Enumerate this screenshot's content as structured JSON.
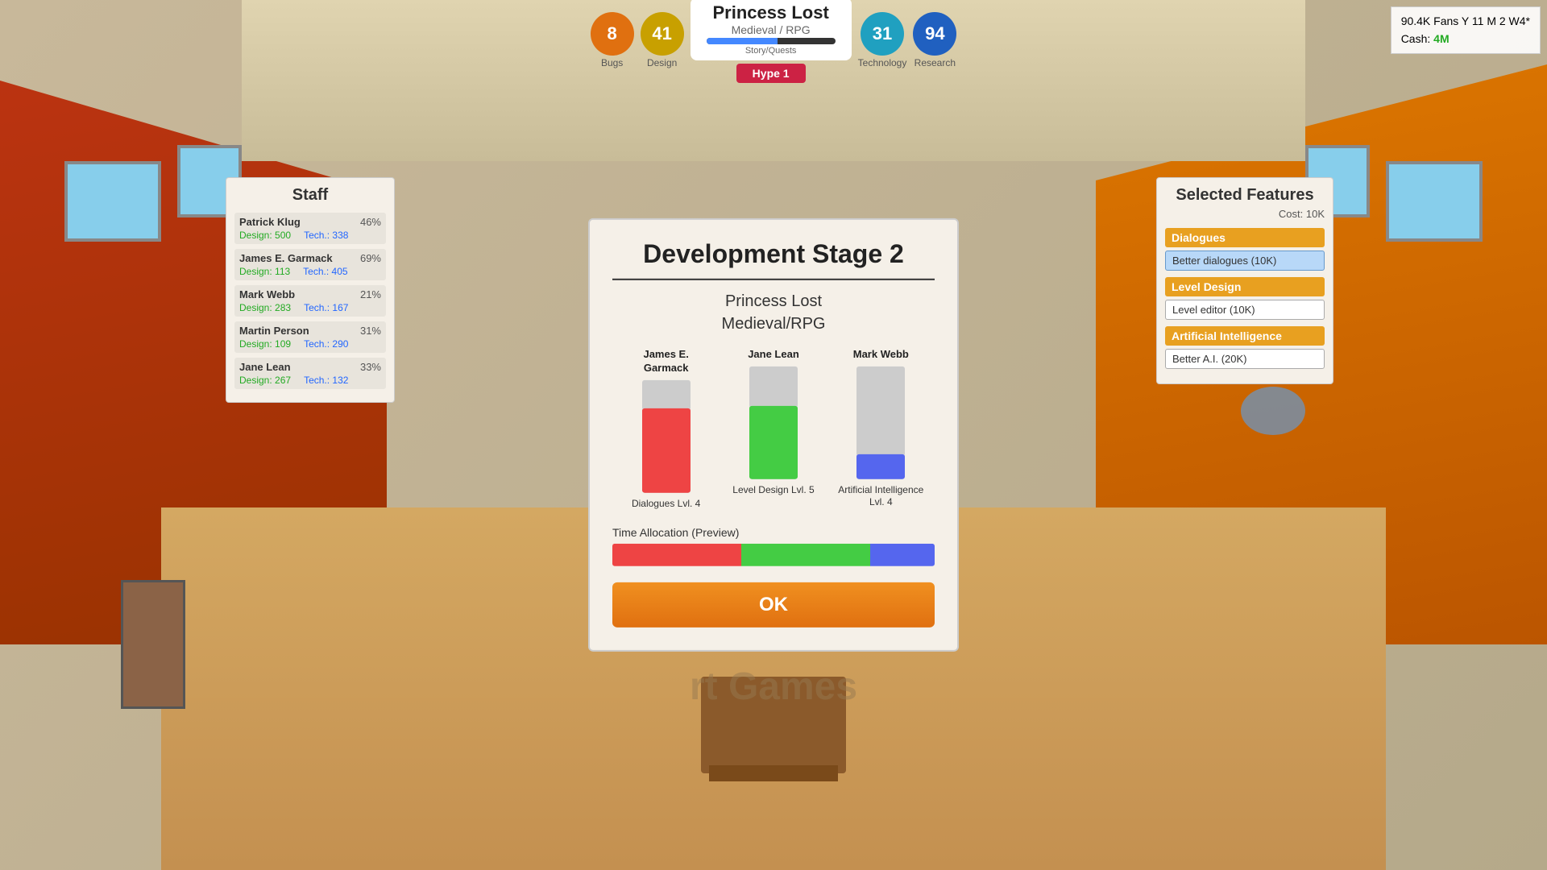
{
  "hud": {
    "bugs_count": "8",
    "bugs_label": "Bugs",
    "design_count": "41",
    "design_label": "Design",
    "game_title": "Princess Lost",
    "game_genre": "Medieval / RPG",
    "story_quests_label": "Story/Quests",
    "technology_count": "31",
    "technology_label": "Technology",
    "research_count": "94",
    "research_label": "Research",
    "hype_label": "Hype 1"
  },
  "stats": {
    "fans": "90.4K Fans Y 11 M 2 W4*",
    "cash_label": "Cash:",
    "cash_value": "4M"
  },
  "staff_panel": {
    "title": "Staff",
    "members": [
      {
        "name": "Patrick Klug",
        "percent": "46%",
        "design_label": "Design:",
        "design_value": "500",
        "tech_label": "Tech.:",
        "tech_value": "338"
      },
      {
        "name": "James E. Garmack",
        "percent": "69%",
        "design_label": "Design:",
        "design_value": "113",
        "tech_label": "Tech.:",
        "tech_value": "405"
      },
      {
        "name": "Mark Webb",
        "percent": "21%",
        "design_label": "Design:",
        "design_value": "283",
        "tech_label": "Tech.:",
        "tech_value": "167"
      },
      {
        "name": "Martin Person",
        "percent": "31%",
        "design_label": "Design:",
        "design_value": "109",
        "tech_label": "Tech.:",
        "tech_value": "290"
      },
      {
        "name": "Jane Lean",
        "percent": "33%",
        "design_label": "Design:",
        "design_value": "267",
        "tech_label": "Tech.:",
        "tech_value": "132"
      }
    ]
  },
  "dialog": {
    "title": "Development Stage 2",
    "game_name": "Princess Lost",
    "game_genre": "Medieval/RPG",
    "staff_bars": [
      {
        "name": "James E. Garmack",
        "fill_color": "red",
        "fill_height": "75",
        "label": "Dialogues Lvl. 4"
      },
      {
        "name": "Jane Lean",
        "fill_color": "green",
        "fill_height": "65",
        "label": "Level Design Lvl. 5"
      },
      {
        "name": "Mark Webb",
        "fill_color": "blue-bar",
        "fill_height": "22",
        "label": "Artificial Intelligence\nLvl. 4"
      }
    ],
    "time_allocation_label": "Time Allocation (Preview)",
    "ok_label": "OK"
  },
  "features_panel": {
    "title": "Selected Features",
    "cost": "Cost: 10K",
    "categories": [
      {
        "name": "Dialogues",
        "items": [
          {
            "label": "Better dialogues (10K)",
            "selected": true
          }
        ]
      },
      {
        "name": "Level Design",
        "items": [
          {
            "label": "Level editor (10K)",
            "selected": false
          }
        ]
      },
      {
        "name": "Artificial Intelligence",
        "items": [
          {
            "label": "Better A.I. (20K)",
            "selected": false
          }
        ]
      }
    ]
  },
  "company": {
    "name": "rt Games"
  }
}
